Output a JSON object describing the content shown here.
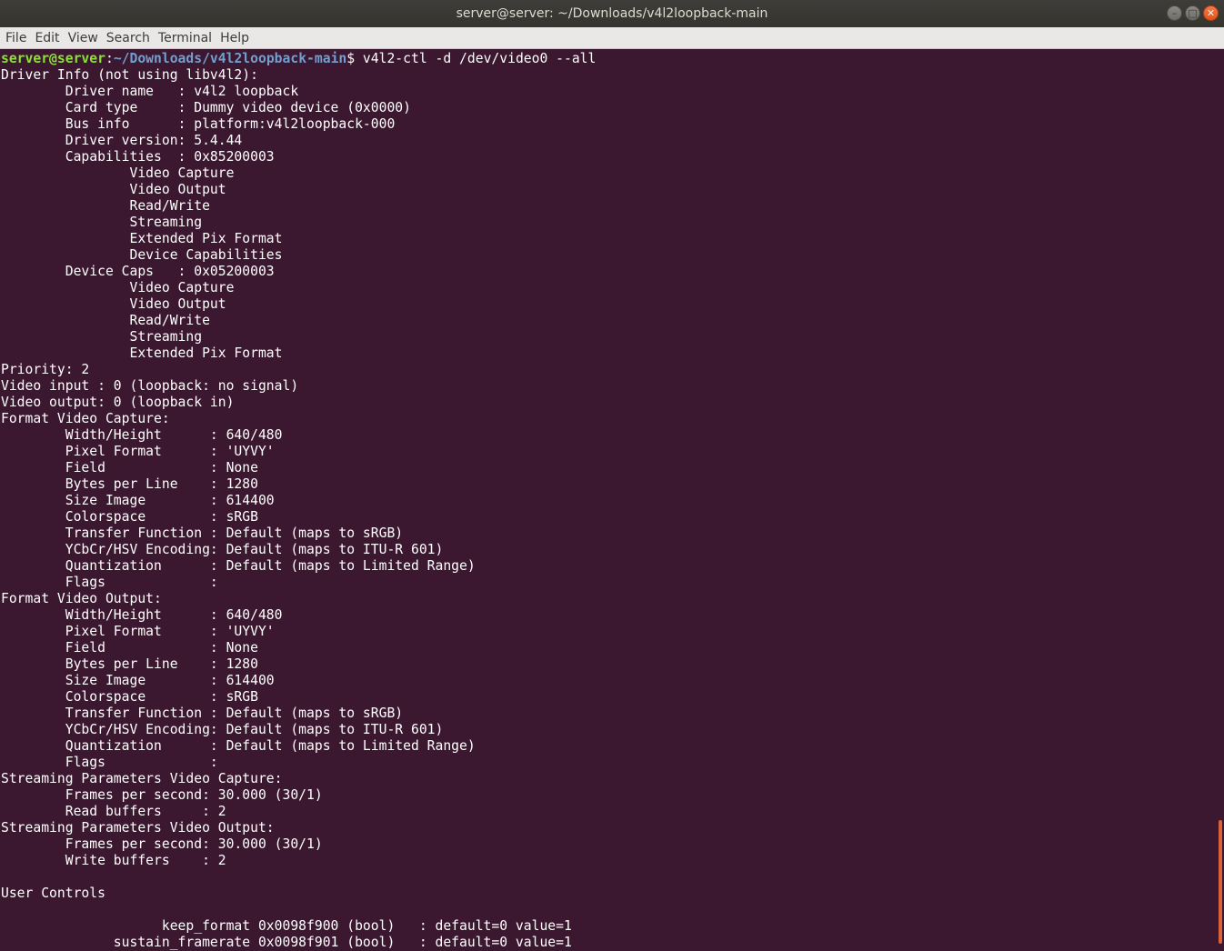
{
  "window": {
    "title": "server@server: ~/Downloads/v4l2loopback-main"
  },
  "menubar": {
    "items": [
      "File",
      "Edit",
      "View",
      "Search",
      "Terminal",
      "Help"
    ]
  },
  "prompt": {
    "user_host": "server@server",
    "colon": ":",
    "path": "~/Downloads/v4l2loopback-main",
    "symbol": "$",
    "command": " v4l2-ctl -d /dev/video0 --all"
  },
  "colors": {
    "background": "#3c1830",
    "prompt_user": "#8ae234",
    "prompt_path": "#729fcf",
    "text": "#ffffff",
    "scroll_thumb": "#d8623a"
  },
  "output_lines": [
    "Driver Info (not using libv4l2):",
    "\tDriver name   : v4l2 loopback",
    "\tCard type     : Dummy video device (0x0000)",
    "\tBus info      : platform:v4l2loopback-000",
    "\tDriver version: 5.4.44",
    "\tCapabilities  : 0x85200003",
    "\t\tVideo Capture",
    "\t\tVideo Output",
    "\t\tRead/Write",
    "\t\tStreaming",
    "\t\tExtended Pix Format",
    "\t\tDevice Capabilities",
    "\tDevice Caps   : 0x05200003",
    "\t\tVideo Capture",
    "\t\tVideo Output",
    "\t\tRead/Write",
    "\t\tStreaming",
    "\t\tExtended Pix Format",
    "Priority: 2",
    "Video input : 0 (loopback: no signal)",
    "Video output: 0 (loopback in)",
    "Format Video Capture:",
    "\tWidth/Height      : 640/480",
    "\tPixel Format      : 'UYVY'",
    "\tField             : None",
    "\tBytes per Line    : 1280",
    "\tSize Image        : 614400",
    "\tColorspace        : sRGB",
    "\tTransfer Function : Default (maps to sRGB)",
    "\tYCbCr/HSV Encoding: Default (maps to ITU-R 601)",
    "\tQuantization      : Default (maps to Limited Range)",
    "\tFlags             : ",
    "Format Video Output:",
    "\tWidth/Height      : 640/480",
    "\tPixel Format      : 'UYVY'",
    "\tField             : None",
    "\tBytes per Line    : 1280",
    "\tSize Image        : 614400",
    "\tColorspace        : sRGB",
    "\tTransfer Function : Default (maps to sRGB)",
    "\tYCbCr/HSV Encoding: Default (maps to ITU-R 601)",
    "\tQuantization      : Default (maps to Limited Range)",
    "\tFlags             : ",
    "Streaming Parameters Video Capture:",
    "\tFrames per second: 30.000 (30/1)",
    "\tRead buffers     : 2",
    "Streaming Parameters Video Output:",
    "\tFrames per second: 30.000 (30/1)",
    "\tWrite buffers    : 2",
    "",
    "User Controls",
    "",
    "                    keep_format 0x0098f900 (bool)   : default=0 value=1",
    "              sustain_framerate 0x0098f901 (bool)   : default=0 value=1"
  ]
}
